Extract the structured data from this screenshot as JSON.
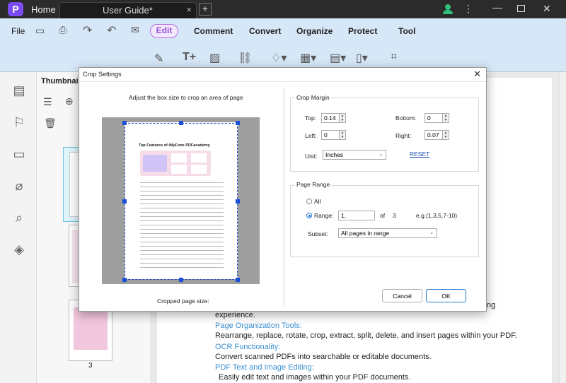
{
  "app": {
    "icon_letter": "P",
    "home_label": "Home",
    "doc_tab": "User Guide*",
    "close_tab": "×",
    "new_tab": "+"
  },
  "menu": {
    "file": "File",
    "edit": "Edit",
    "comment": "Comment",
    "convert": "Convert",
    "organize": "Organize",
    "protect": "Protect",
    "tool": "Tool"
  },
  "panel": {
    "title": "Thumbnai",
    "page_number": "3"
  },
  "document": {
    "lines": [
      {
        "text": "experience.",
        "type": "body"
      },
      {
        "text": "Page Organization Tools:",
        "type": "link"
      },
      {
        "text": "Rearrange, replace, rotate, crop, extract, split, delete, and insert pages within your PDF.",
        "type": "body"
      },
      {
        "text": "OCR Functionality:",
        "type": "link"
      },
      {
        "text": "Convert scanned PDFs into searchable or editable documents.",
        "type": "body"
      },
      {
        "text": "PDF Text and Image Editing:",
        "type": "link"
      },
      {
        "text": "Easily edit text and images within your PDF documents.",
        "type": "body"
      }
    ],
    "partial_right": "ng"
  },
  "dialog": {
    "title": "Crop Settings",
    "close": "✕",
    "instruction": "Adjust the box size to crop an area of page",
    "preview_title": "Top Features of iMyFone PDFacademy",
    "cropped_size_label": "Cropped page size:",
    "crop_margin": {
      "legend": "Crop Margin",
      "top_label": "Top:",
      "top_value": "0.14",
      "bottom_label": "Bottom:",
      "bottom_value": "0",
      "left_label": "Left:",
      "left_value": "0",
      "right_label": "Right:",
      "right_value": "0.07",
      "unit_label": "Unit:",
      "unit_value": "Inches",
      "reset": "RESET"
    },
    "page_range": {
      "legend": "Page Range",
      "all_label": "All",
      "range_label": "Range:",
      "range_value": "1,",
      "of_label": "of",
      "total_pages": "3",
      "example": "e.g.(1,3,5,7-10)",
      "subset_label": "Subset:",
      "subset_value": "All pages in range"
    },
    "cancel": "Cancel",
    "ok": "OK"
  },
  "colors": {
    "accent": "#9b4fd9",
    "toolbar_bg": "#d6e7f7",
    "link": "#3a8fd0",
    "handle": "#1a4fd8"
  }
}
